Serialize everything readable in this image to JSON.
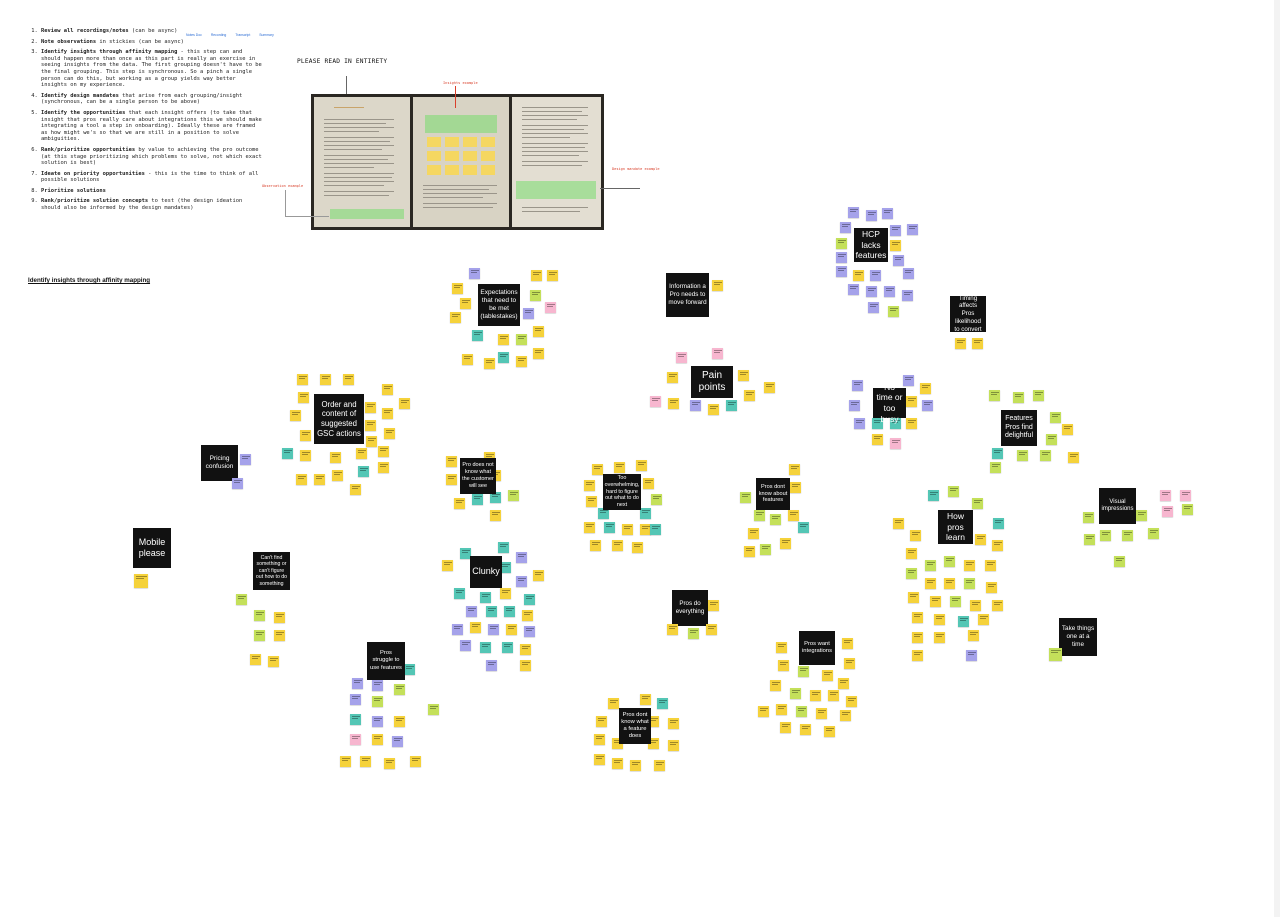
{
  "board": {
    "instructions": {
      "steps": [
        {
          "title": "Review all recordings/notes",
          "text": " (can be async)"
        },
        {
          "title": "Note observations",
          "text": " in stickies (can be async)"
        },
        {
          "title": "Identify insights through affinity mapping",
          "text": " - this step can and should happen more than once as this part is really an exercise in seeing insights from the data. The first grouping doesn't have to be the final grouping. This step is synchronous. So a pinch a single person can do this, but working as a group yields way better insights on my experience."
        },
        {
          "title": "Identify design mandates",
          "text": " that arise from each grouping/insight (synchronous, can be a single person to be above)"
        },
        {
          "title": "Identify the opportunities",
          "text": " that each insight offers (to take that insight that pros really care about integrations this we should make integrating a tool a step in onboarding). Ideally these are framed as how might we's so that we are still in a position to solve ambiguities."
        },
        {
          "title": "Rank/prioritize opportunities",
          "text": " by value to achieving the pro outcome (at this stage prioritizing which problems to solve, not which exact solution is best)"
        },
        {
          "title": "Ideate on priority opportunities",
          "text": " - this is the time to think of all possible solutions"
        },
        {
          "title": "Prioritize solutions",
          "text": ""
        },
        {
          "title": "Rank/prioritize solution concepts",
          "text": " to test (the design ideation should also be informed by the design mandates)"
        }
      ],
      "links": [
        "Notes Doc",
        "Recording",
        "Transcript",
        "Summary"
      ]
    },
    "read_label": "PLEASE READ IN ENTIRETY",
    "photo_annotations": {
      "insights": "Insights example",
      "observation": "Observation example",
      "design_mandate": "Design mandate example"
    },
    "section_heading": "Identify insights through affinity mapping",
    "clusters": [
      {
        "id": "expectations",
        "label": "Expectations that need to be met (tablestakes)"
      },
      {
        "id": "information",
        "label": "Information a Pro needs to move forward"
      },
      {
        "id": "hcp-lacks",
        "label": "HCP lacks features"
      },
      {
        "id": "timing",
        "label": "Timing affects Pros likelihood to convert"
      },
      {
        "id": "pain-points",
        "label": "Pain points"
      },
      {
        "id": "no-time",
        "label": "No time or too busy"
      },
      {
        "id": "order-content",
        "label": "Order and content of suggested GSC actions"
      },
      {
        "id": "features-delight",
        "label": "Features Pros find delightful"
      },
      {
        "id": "pricing",
        "label": "Pricing confusion"
      },
      {
        "id": "pro-does-not-know",
        "label": "Pro does not know what the customer will see"
      },
      {
        "id": "too-overwhelming",
        "label": "Too overwhelming, hard to figure out what to do next"
      },
      {
        "id": "dont-know-features",
        "label": "Pros dont know about features"
      },
      {
        "id": "visual",
        "label": "Visual impressions"
      },
      {
        "id": "mobile",
        "label": "Mobile please"
      },
      {
        "id": "how-learn",
        "label": "How pros learn"
      },
      {
        "id": "cant-find",
        "label": "Can't find something or can't figure out how to do something"
      },
      {
        "id": "clunky",
        "label": "Clunky"
      },
      {
        "id": "do-everything",
        "label": "Pros do everything"
      },
      {
        "id": "want-integrations",
        "label": "Pros want integrations"
      },
      {
        "id": "take-things",
        "label": "Take things one at a time"
      },
      {
        "id": "struggle",
        "label": "Pros struggle to use features"
      },
      {
        "id": "dont-know-what",
        "label": "Pros dont know what a feature does"
      }
    ]
  }
}
